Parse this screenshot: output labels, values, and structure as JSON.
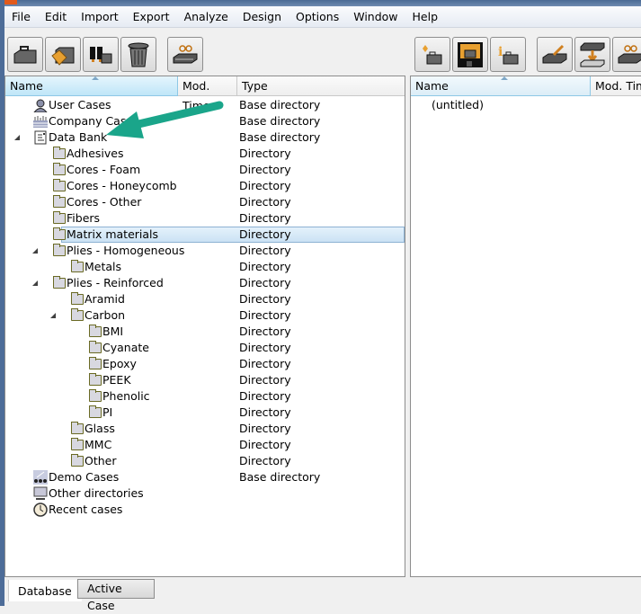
{
  "menu": [
    "File",
    "Edit",
    "Import",
    "Export",
    "Analyze",
    "Design",
    "Options",
    "Window",
    "Help"
  ],
  "left_toolbar": [
    "open-case-icon",
    "open-folder-icon",
    "find-icon",
    "trash-icon",
    "view-material-icon"
  ],
  "right_toolbar": [
    "new-case-icon",
    "save-case-icon",
    "case-info-icon",
    "edit-material-icon",
    "import-material-icon",
    "view-material-icon"
  ],
  "left_panel": {
    "columns": {
      "name": "Name",
      "mod_time": "Mod. Time",
      "type": "Type"
    },
    "rows": [
      {
        "level": 0,
        "toggle": "closed",
        "icon": "user-icon",
        "name": "User Cases",
        "type": "Base directory"
      },
      {
        "level": 0,
        "toggle": "none",
        "icon": "company-icon",
        "name": "Company Cases",
        "type": "Base directory"
      },
      {
        "level": 0,
        "toggle": "open",
        "icon": "databank-icon",
        "name": "Data Bank",
        "type": "Base directory"
      },
      {
        "level": 1,
        "toggle": "closed",
        "icon": "folder-icon",
        "name": "Adhesives",
        "type": "Directory"
      },
      {
        "level": 1,
        "toggle": "closed",
        "icon": "folder-icon",
        "name": "Cores - Foam",
        "type": "Directory"
      },
      {
        "level": 1,
        "toggle": "closed",
        "icon": "folder-icon",
        "name": "Cores - Honeycomb",
        "type": "Directory"
      },
      {
        "level": 1,
        "toggle": "closed",
        "icon": "folder-icon",
        "name": "Cores - Other",
        "type": "Directory"
      },
      {
        "level": 1,
        "toggle": "closed",
        "icon": "folder-icon",
        "name": "Fibers",
        "type": "Directory"
      },
      {
        "level": 1,
        "toggle": "closed",
        "icon": "folder-icon",
        "name": "Matrix materials",
        "type": "Directory",
        "selected": true
      },
      {
        "level": 1,
        "toggle": "open",
        "icon": "folder-icon",
        "name": "Plies - Homogeneous",
        "type": "Directory"
      },
      {
        "level": 2,
        "toggle": "closed",
        "icon": "folder-icon",
        "name": "Metals",
        "type": "Directory"
      },
      {
        "level": 1,
        "toggle": "open",
        "icon": "folder-icon",
        "name": "Plies - Reinforced",
        "type": "Directory"
      },
      {
        "level": 2,
        "toggle": "closed",
        "icon": "folder-icon",
        "name": "Aramid",
        "type": "Directory"
      },
      {
        "level": 2,
        "toggle": "open",
        "icon": "folder-icon",
        "name": "Carbon",
        "type": "Directory"
      },
      {
        "level": 3,
        "toggle": "closed",
        "icon": "folder-icon",
        "name": "BMI",
        "type": "Directory"
      },
      {
        "level": 3,
        "toggle": "closed",
        "icon": "folder-icon",
        "name": "Cyanate",
        "type": "Directory"
      },
      {
        "level": 3,
        "toggle": "closed",
        "icon": "folder-icon",
        "name": "Epoxy",
        "type": "Directory"
      },
      {
        "level": 3,
        "toggle": "closed",
        "icon": "folder-icon",
        "name": "PEEK",
        "type": "Directory"
      },
      {
        "level": 3,
        "toggle": "closed",
        "icon": "folder-icon",
        "name": "Phenolic",
        "type": "Directory"
      },
      {
        "level": 3,
        "toggle": "closed",
        "icon": "folder-icon",
        "name": "PI",
        "type": "Directory"
      },
      {
        "level": 2,
        "toggle": "closed",
        "icon": "folder-icon",
        "name": "Glass",
        "type": "Directory"
      },
      {
        "level": 2,
        "toggle": "closed",
        "icon": "folder-icon",
        "name": "MMC",
        "type": "Directory"
      },
      {
        "level": 2,
        "toggle": "closed",
        "icon": "folder-icon",
        "name": "Other",
        "type": "Directory"
      },
      {
        "level": 0,
        "toggle": "closed",
        "icon": "demo-cases-icon",
        "name": "Demo Cases",
        "type": "Base directory"
      },
      {
        "level": 0,
        "toggle": "closed",
        "icon": "computer-icon",
        "name": "Other directories",
        "type": ""
      },
      {
        "level": 0,
        "toggle": "closed",
        "icon": "clock-icon",
        "name": "Recent cases",
        "type": ""
      }
    ]
  },
  "right_panel": {
    "columns": {
      "name": "Name",
      "mod_time": "Mod. Time"
    },
    "rows": [
      "(untitled)"
    ]
  },
  "tabs": {
    "database": "Database",
    "active_case": "Active Case"
  },
  "colors": {
    "annotation_arrow": "#1aa58a",
    "selection": "#cbe2f4"
  }
}
